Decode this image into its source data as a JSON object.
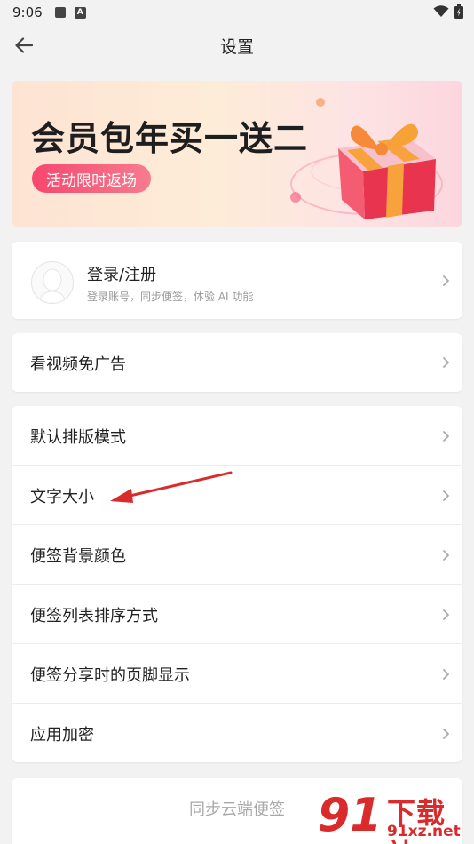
{
  "status_bar": {
    "time": "9:06",
    "notif_letter": "A"
  },
  "app_bar": {
    "title": "设置"
  },
  "banner": {
    "title": "会员包年买一送二",
    "pill": "活动限时返场"
  },
  "login": {
    "title": "登录/注册",
    "subtitle": "登录账号，同步便签，体验 AI 功能"
  },
  "ad_free": {
    "label": "看视频免广告"
  },
  "settings": {
    "items": [
      {
        "label": "默认排版模式"
      },
      {
        "label": "文字大小"
      },
      {
        "label": "便签背景颜色"
      },
      {
        "label": "便签列表排序方式"
      },
      {
        "label": "便签分享时的页脚显示"
      },
      {
        "label": "应用加密"
      }
    ]
  },
  "sync": {
    "label": "同步云端便签"
  },
  "watermark": {
    "big": "91",
    "text": "下载站",
    "url": "91xz.net"
  },
  "colors": {
    "accent": "#f7476f",
    "annotation": "#d92b2b",
    "background": "#f2f2f2"
  }
}
